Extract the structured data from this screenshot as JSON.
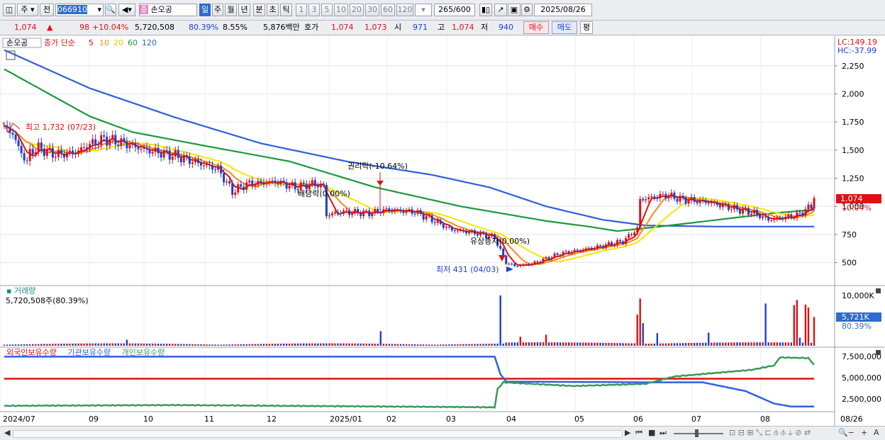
{
  "toolbar": {
    "type_label": "주",
    "prev_label": "전",
    "code": "066910",
    "marker_label": "종",
    "name": "손오공",
    "tf_buttons": [
      "일",
      "주",
      "월",
      "년",
      "분",
      "초",
      "틱"
    ],
    "tf_numbers": [
      "1",
      "3",
      "5",
      "10",
      "20",
      "30",
      "60",
      "120"
    ],
    "count": "265",
    "total": "/600",
    "date": "2025/08/26"
  },
  "quote": {
    "price": "1,074",
    "change": "98",
    "rate": "+10.04%",
    "volume": "5,720,508",
    "vol_ratio": "80.39%",
    "turnover": "8.55%",
    "amount": "5,876백만",
    "bid_label": "호가",
    "ask": "1,074",
    "bid": "1,073",
    "open_label": "시",
    "open": "971",
    "high_label": "고",
    "high": "1,074",
    "low_label": "저",
    "low": "940",
    "buy_label": "매수",
    "sell_label": "매도",
    "eval_label": "평"
  },
  "colors": {
    "up": "#e01010",
    "down": "#1a3fd0",
    "ma5": "#e01010",
    "ma10": "#f28c1a",
    "ma20": "#f7e600",
    "ma60": "#1a9a3c",
    "ma120": "#2f5fd8",
    "foreign": "#e01010",
    "inst": "#3060e0",
    "indiv": "#3a9a5a",
    "highlight": "#2f6ccf"
  },
  "chart_data": [
    {
      "type": "candlestick",
      "title": "손오공",
      "legend": {
        "prefix": "종가 단순",
        "periods": [
          "5",
          "10",
          "20",
          "60",
          "120"
        ]
      },
      "right_header": {
        "lc": "LC:149.19",
        "hc": "HC:-37.99"
      },
      "x_labels": [
        "2024/07",
        "09",
        "10",
        "11",
        "12",
        "2025/01",
        "02",
        "03",
        "04",
        "05",
        "06",
        "07",
        "08",
        "08/26"
      ],
      "y_ticks": [
        500,
        750,
        1000,
        1250,
        1500,
        1750,
        2000,
        2250
      ],
      "ylim": [
        340,
        2400
      ],
      "last_price": "1,074",
      "last_rate": "10.04%",
      "annotations": [
        {
          "text": "최고 1,732 (07/23)"
        },
        {
          "text": "권리락(-10.64%)"
        },
        {
          "text": "배당락(0.00%)"
        },
        {
          "text": "유상증자(0.00%)"
        },
        {
          "text": "최저 431 (04/03)"
        }
      ],
      "close_knots": [
        [
          0,
          1700
        ],
        [
          3,
          1650
        ],
        [
          5,
          1520
        ],
        [
          8,
          1390
        ],
        [
          9,
          1480
        ],
        [
          12,
          1520
        ],
        [
          18,
          1460
        ],
        [
          25,
          1480
        ],
        [
          30,
          1550
        ],
        [
          35,
          1600
        ],
        [
          42,
          1560
        ],
        [
          50,
          1500
        ],
        [
          60,
          1450
        ],
        [
          66,
          1400
        ],
        [
          75,
          1330
        ],
        [
          80,
          1130
        ],
        [
          85,
          1200
        ],
        [
          95,
          1220
        ],
        [
          102,
          1170
        ],
        [
          108,
          1200
        ],
        [
          112,
          1180
        ],
        [
          113,
          920
        ],
        [
          118,
          950
        ],
        [
          128,
          940
        ],
        [
          134,
          970
        ],
        [
          144,
          950
        ],
        [
          150,
          880
        ],
        [
          157,
          790
        ],
        [
          166,
          760
        ],
        [
          172,
          720
        ],
        [
          176,
          500
        ],
        [
          179,
          470
        ],
        [
          185,
          490
        ],
        [
          195,
          580
        ],
        [
          208,
          640
        ],
        [
          217,
          690
        ],
        [
          222,
          800
        ],
        [
          223,
          1060
        ],
        [
          232,
          1100
        ],
        [
          238,
          1060
        ],
        [
          246,
          1040
        ],
        [
          256,
          980
        ],
        [
          263,
          940
        ],
        [
          268,
          880
        ],
        [
          278,
          920
        ],
        [
          283,
          1000
        ],
        [
          284,
          1074
        ]
      ],
      "ma120_knots": [
        [
          0,
          2390
        ],
        [
          30,
          2050
        ],
        [
          60,
          1790
        ],
        [
          90,
          1560
        ],
        [
          120,
          1400
        ],
        [
          150,
          1280
        ],
        [
          170,
          1170
        ],
        [
          190,
          1000
        ],
        [
          210,
          880
        ],
        [
          225,
          830
        ],
        [
          250,
          820
        ],
        [
          284,
          820
        ]
      ],
      "ma60_knots": [
        [
          0,
          2220
        ],
        [
          30,
          1800
        ],
        [
          45,
          1660
        ],
        [
          70,
          1540
        ],
        [
          100,
          1400
        ],
        [
          130,
          1170
        ],
        [
          160,
          1000
        ],
        [
          190,
          870
        ],
        [
          205,
          820
        ],
        [
          215,
          780
        ],
        [
          230,
          820
        ],
        [
          250,
          880
        ],
        [
          270,
          940
        ],
        [
          284,
          970
        ]
      ],
      "volume": {
        "title": "거래량",
        "last": "5,720,508주(80.39%)",
        "y_tick": "10,000K",
        "last_label": "5,721K",
        "last_pct": "80.39%",
        "spikes": [
          [
            43,
            1200
          ],
          [
            132,
            2900
          ],
          [
            174,
            10200
          ],
          [
            181,
            1800
          ],
          [
            190,
            2200
          ],
          [
            222,
            6200
          ],
          [
            223,
            9400
          ],
          [
            224,
            4500
          ],
          [
            229,
            2500
          ],
          [
            247,
            2600
          ],
          [
            267,
            8400
          ],
          [
            277,
            8100
          ],
          [
            278,
            9100
          ],
          [
            279,
            1600
          ],
          [
            281,
            8200
          ],
          [
            282,
            7600
          ],
          [
            284,
            5720
          ]
        ]
      },
      "holdings": {
        "legend": [
          "외국인보유수량",
          "기관보유수량",
          "개인보유수량"
        ],
        "y_ticks": [
          "7,500,000",
          "5,000,000",
          "2,500,000"
        ],
        "ylim": [
          0,
          8500000
        ],
        "foreign": 4400000,
        "inst_knots": [
          [
            0,
            7400000
          ],
          [
            172,
            7400000
          ],
          [
            174,
            5000000
          ],
          [
            176,
            4000000
          ],
          [
            225,
            3900000
          ],
          [
            245,
            3900000
          ],
          [
            260,
            2700000
          ],
          [
            270,
            1000000
          ],
          [
            276,
            600000
          ],
          [
            284,
            600000
          ]
        ],
        "indiv_knots": [
          [
            0,
            700000
          ],
          [
            60,
            800000
          ],
          [
            172,
            500000
          ],
          [
            173,
            3000000
          ],
          [
            175,
            3900000
          ],
          [
            200,
            3400000
          ],
          [
            225,
            3700000
          ],
          [
            235,
            4700000
          ],
          [
            250,
            5200000
          ],
          [
            262,
            5600000
          ],
          [
            270,
            6200000
          ],
          [
            272,
            7300000
          ],
          [
            282,
            7200000
          ],
          [
            284,
            6300000
          ]
        ]
      }
    }
  ],
  "statusbar": {
    "icons": [
      "scroll-left-icon",
      "nav-first-icon",
      "nav-prev-icon",
      "stop-icon",
      "nav-next-icon",
      "zoom-out-icon",
      "zoom-in-icon",
      "home-icon"
    ]
  }
}
